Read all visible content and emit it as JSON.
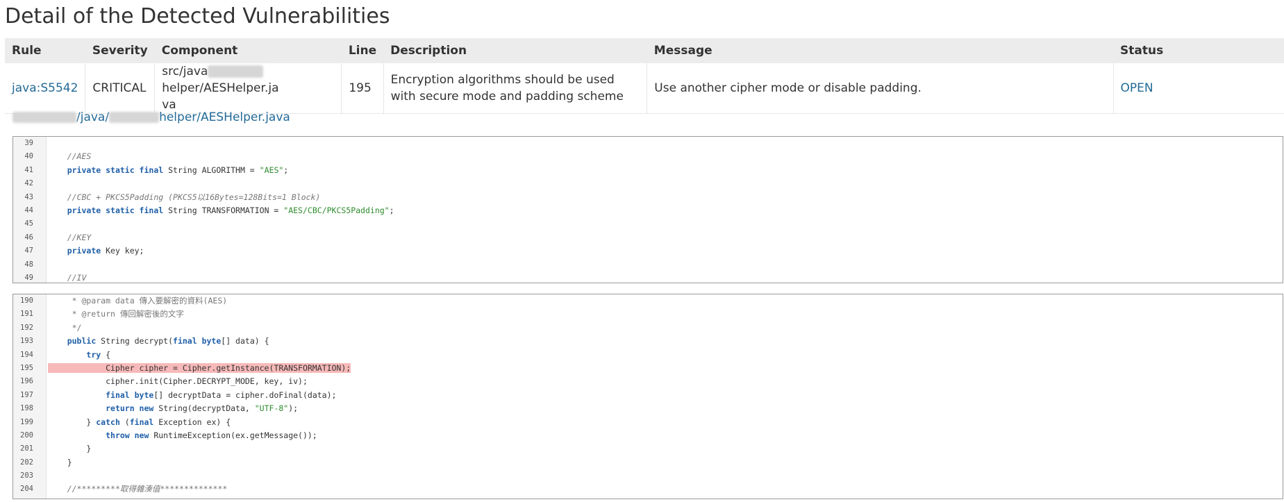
{
  "page": {
    "title": "Detail of the Detected Vulnerabilities"
  },
  "table": {
    "headers": [
      "Rule",
      "Severity",
      "Component",
      "Line",
      "Description",
      "Message",
      "Status"
    ],
    "row": {
      "rule": "java:S5542",
      "severity": "CRITICAL",
      "component_prefix": "src/java",
      "component_suffix": "helper/AESHelper.ja",
      "component_end": "va",
      "line": "195",
      "description": "Encryption algorithms should be used with secure mode and padding scheme",
      "message": "Use another cipher mode or disable padding.",
      "status": "OPEN"
    }
  },
  "file_path": {
    "segment_java": "/java/",
    "segment_file": "helper/AESHelper.java"
  },
  "colors": {
    "link": "#236a97",
    "highlight": "#f7b9b9",
    "keyword": "#1f5fa8",
    "string": "#2e8b2e",
    "comment": "#777777"
  },
  "snippets": [
    {
      "lines": [
        {
          "n": "39",
          "tokens": []
        },
        {
          "n": "40",
          "tokens": [
            [
              "",
              "    "
            ],
            [
              "cmt",
              "//AES"
            ]
          ]
        },
        {
          "n": "41",
          "tokens": [
            [
              "",
              "    "
            ],
            [
              "kw",
              "private static final"
            ],
            [
              "",
              " String ALGORITHM = "
            ],
            [
              "str",
              "\"AES\""
            ],
            [
              "",
              ";"
            ]
          ]
        },
        {
          "n": "42",
          "tokens": []
        },
        {
          "n": "43",
          "tokens": [
            [
              "",
              "    "
            ],
            [
              "cmt",
              "//CBC + PKCS5Padding (PKCS5以16Bytes=128Bits=1 Block)"
            ]
          ]
        },
        {
          "n": "44",
          "tokens": [
            [
              "",
              "    "
            ],
            [
              "kw",
              "private static final"
            ],
            [
              "",
              " String TRANSFORMATION = "
            ],
            [
              "str",
              "\"AES/CBC/PKCS5Padding\""
            ],
            [
              "",
              ";"
            ]
          ]
        },
        {
          "n": "45",
          "tokens": []
        },
        {
          "n": "46",
          "tokens": [
            [
              "",
              "    "
            ],
            [
              "cmt",
              "//KEY"
            ]
          ]
        },
        {
          "n": "47",
          "tokens": [
            [
              "",
              "    "
            ],
            [
              "kw",
              "private"
            ],
            [
              "",
              " Key key;"
            ]
          ]
        },
        {
          "n": "48",
          "tokens": []
        },
        {
          "n": "49",
          "tokens": [
            [
              "",
              "    "
            ],
            [
              "cmt",
              "//IV"
            ]
          ]
        }
      ]
    },
    {
      "lines": [
        {
          "n": "190",
          "tokens": [
            [
              "doc",
              "     * @param data 傳入要解密的資料(AES)"
            ]
          ]
        },
        {
          "n": "191",
          "tokens": [
            [
              "doc",
              "     * @return 傳回解密後的文字"
            ]
          ]
        },
        {
          "n": "192",
          "tokens": [
            [
              "doc",
              "     */"
            ]
          ]
        },
        {
          "n": "193",
          "tokens": [
            [
              "",
              "    "
            ],
            [
              "kw",
              "public"
            ],
            [
              "",
              " String decrypt("
            ],
            [
              "kw",
              "final byte"
            ],
            [
              "",
              "[] data) {"
            ]
          ]
        },
        {
          "n": "194",
          "tokens": [
            [
              "",
              "        "
            ],
            [
              "kw",
              "try"
            ],
            [
              "",
              " {"
            ]
          ]
        },
        {
          "n": "195",
          "highlight": true,
          "tokens": [
            [
              "hl",
              "            Cipher cipher = Cipher.getInstance(TRANSFORMATION);"
            ]
          ]
        },
        {
          "n": "196",
          "tokens": [
            [
              "",
              "            cipher.init(Cipher.DECRYPT_MODE, key, iv);"
            ]
          ]
        },
        {
          "n": "197",
          "tokens": [
            [
              "",
              "            "
            ],
            [
              "kw",
              "final byte"
            ],
            [
              "",
              "[] decryptData = cipher.doFinal(data);"
            ]
          ]
        },
        {
          "n": "198",
          "tokens": [
            [
              "",
              "            "
            ],
            [
              "kw",
              "return new"
            ],
            [
              "",
              " String(decryptData, "
            ],
            [
              "str",
              "\"UTF-8\""
            ],
            [
              "",
              ");"
            ]
          ]
        },
        {
          "n": "199",
          "tokens": [
            [
              "",
              "        } "
            ],
            [
              "kw",
              "catch"
            ],
            [
              "",
              " ("
            ],
            [
              "kw",
              "final"
            ],
            [
              "",
              " Exception ex) {"
            ]
          ]
        },
        {
          "n": "200",
          "tokens": [
            [
              "",
              "            "
            ],
            [
              "kw",
              "throw new"
            ],
            [
              "",
              " RuntimeException(ex.getMessage());"
            ]
          ]
        },
        {
          "n": "201",
          "tokens": [
            [
              "",
              "        }"
            ]
          ]
        },
        {
          "n": "202",
          "tokens": [
            [
              "",
              "    }"
            ]
          ]
        },
        {
          "n": "203",
          "tokens": []
        },
        {
          "n": "204",
          "tokens": [
            [
              "",
              "    "
            ],
            [
              "cmt",
              "//*********取得雜湊值**************"
            ]
          ]
        }
      ]
    }
  ]
}
